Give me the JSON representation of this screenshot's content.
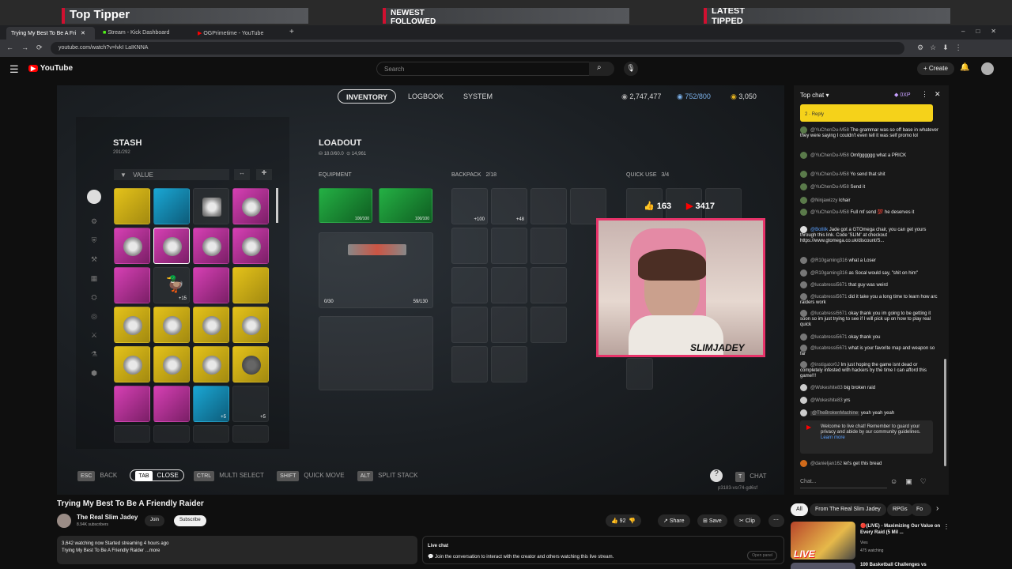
{
  "overlay": {
    "top_tipper": "Top Tipper",
    "newest_label": "NEWEST",
    "newest_sub": "FOLLOWED",
    "latest_label": "LATEST",
    "latest_sub": "TIPPED"
  },
  "browser": {
    "tabs": [
      {
        "label": "Trying My Best To Be A Fri"
      },
      {
        "label": "Stream - Kick Dashboard"
      },
      {
        "label": "OGPrimetime - YouTube"
      }
    ],
    "url": "youtube.com/watch?v=lvkI LaIKNNA"
  },
  "youtube": {
    "logo": "YouTube",
    "search_placeholder": "Search",
    "create_label": "Create"
  },
  "game": {
    "tabs": [
      "INVENTORY",
      "LOGBOOK",
      "SYSTEM"
    ],
    "currency": [
      "2,747,477",
      "752/800",
      "3,050"
    ],
    "stash_title": "STASH",
    "stash_count": "291/292",
    "value_label": "VALUE",
    "loadout_title": "LOADOUT",
    "loadout_weight": "18.0/60.0",
    "loadout_value": "14,961",
    "equipment_label": "EQUIPMENT",
    "equip_dur_1": "100/100",
    "equip_dur_2": "100/100",
    "backpack_label": "BACKPACK",
    "backpack_count": "2/18",
    "bp_qty_1": "+100",
    "bp_qty_2": "+48",
    "quickuse_label": "QUICK USE",
    "quickuse_count": "3/4",
    "ammo_1": "0/30",
    "ammo_2": "59/130",
    "likes_overlay": "163",
    "yt_overlay": "3417",
    "stash_qty": [
      "+3",
      "+3",
      "+3",
      "+15",
      "+5",
      "+5"
    ],
    "footer_keys": [
      {
        "key": "ESC",
        "label": "BACK"
      },
      {
        "key": "TAB",
        "label": "CLOSE"
      },
      {
        "key": "CTRL",
        "label": "MULTI SELECT"
      },
      {
        "key": "SHIFT",
        "label": "QUICK MOVE"
      },
      {
        "key": "ALT",
        "label": "SPLIT STACK"
      }
    ],
    "chat_key": "T",
    "chat_label": "CHAT",
    "build": "p3183-vsr74-gd6sf"
  },
  "webcam": {
    "watermark": "SLIMJADEY"
  },
  "chat": {
    "header": "Top chat",
    "points": "0XP",
    "pinned_reply": "Reply",
    "pinned_count": "2",
    "messages": [
      {
        "author": "@YuChenDu-M58",
        "text": "The grammar was so off base in whatever they were saying I couldn't even tell it was self promo lol"
      },
      {
        "author": "@YuChenDu-M58",
        "text": "Omfgggggg what a PRICK"
      },
      {
        "author": "@YuChenDu-M58",
        "text": "Yo send that shit"
      },
      {
        "author": "@YuChenDu-M58",
        "text": "Send it"
      },
      {
        "author": "@Ninjawizzy",
        "text": "lchair"
      },
      {
        "author": "@YuChenDu-M58",
        "text": "Full mf send 💯 he deserves it"
      },
      {
        "author": "@Botlilk",
        "text": "Jade got a GTOmega chair, you can get yours through this link. Code 'SLIM' at checkout https://www.gtomega.co.uk/discount/S..."
      },
      {
        "author": "@R10gaming316",
        "text": "what a Loser"
      },
      {
        "author": "@R10gaming316",
        "text": "as Socal would say, \"shit on him\""
      },
      {
        "author": "@lucabressi5671",
        "text": "that guy was weird"
      },
      {
        "author": "@lucabressi5671",
        "text": "did it take you a long time to learn how arc raiders work"
      },
      {
        "author": "@lucabressi5671",
        "text": "okay thank you im going to be getting it soon so im just trying to see if I will pick up on how to play real quick"
      },
      {
        "author": "@lucabressi5671",
        "text": "okay thank you"
      },
      {
        "author": "@lucabressi5671",
        "text": "what is your favorite map and weapon so far"
      },
      {
        "author": "@instigator0J",
        "text": "Im just hoping the game isnt dead or completely infested with hackers by the time I can afford this game!!!"
      },
      {
        "author": "@Wokeshite83",
        "text": "big broken raid"
      },
      {
        "author": "@Wokeshite83",
        "text": "yrs"
      },
      {
        "author": "@TheBrokenMachine",
        "text": "yeah yeah yeah"
      }
    ],
    "notice": "Welcome to live chat! Remember to guard your privacy and abide by our community guidelines.",
    "learn_more": "Learn more",
    "last_author": "@danieljan162",
    "last_text": "let's get this bread",
    "input_placeholder": "Chat..."
  },
  "video_info": {
    "title": "Trying My Best To Be A Friendly Raider",
    "channel": "The Real Slim Jadey",
    "subscribers": "8.94K subscribers",
    "join": "Join",
    "subscribe": "Subscribe",
    "likes": "92",
    "share": "Share",
    "save": "Save",
    "clip": "Clip",
    "watching": "3,642 watching now  Started streaming 4 hours ago",
    "desc": "Trying My Best To Be A Friendly Raider ...more",
    "live_chat_title": "Live chat",
    "live_chat_text": "Join the conversation to interact with the creator and others watching this live stream.",
    "open_panel": "Open panel"
  },
  "recommend": {
    "chips": [
      "All",
      "From The Real Slim Jadey",
      "RPGs",
      "Fo"
    ],
    "videos": [
      {
        "title": "🔴(LIVE) - Maximizing Our Value on Every Raid (5 Mil ...",
        "channel": "Vies",
        "meta": "475 watching"
      },
      {
        "title": "100 Basketball Challenges vs",
        "channel": "",
        "meta": ""
      }
    ],
    "live_badge": "LIVE"
  }
}
